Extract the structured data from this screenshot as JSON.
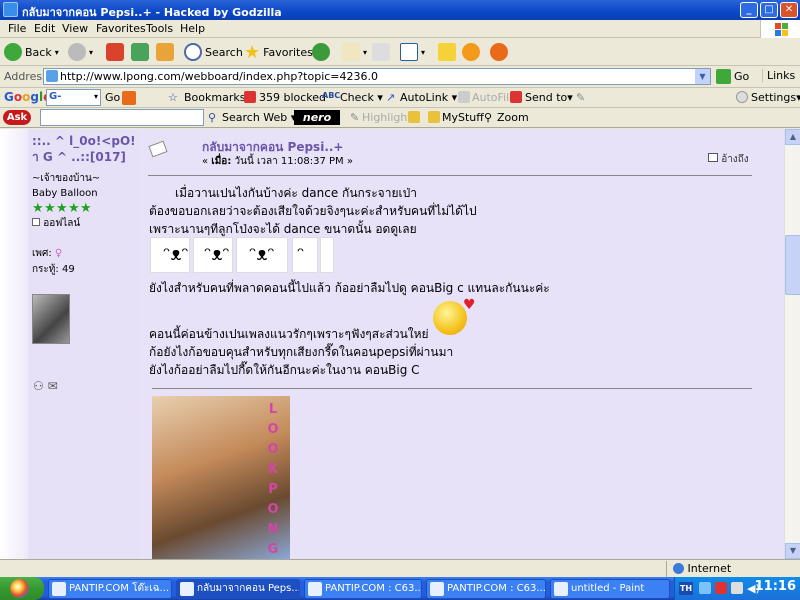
{
  "window": {
    "title": "กลับมาจากคอน Pepsi..+ - Hacked by Godzilla"
  },
  "menu": [
    "File",
    "Edit",
    "View",
    "Favorites",
    "Tools",
    "Help"
  ],
  "toolbar": {
    "back": "Back",
    "search": "Search",
    "favorites": "Favorites"
  },
  "address": {
    "label": "Address",
    "url": "http://www.lpong.com/webboard/index.php?topic=4236.0",
    "go": "Go",
    "links": "Links"
  },
  "googlebar": {
    "logo": "Google",
    "search_placeholder": "G-",
    "go": "Go",
    "bookmarks": "Bookmarks▾",
    "blocked": "359 blocked",
    "check": "Check ▾",
    "autolink": "AutoLink ▾",
    "autofill": "AutoFill",
    "sendto": "Send to▾",
    "settings": "Settings▾"
  },
  "askbar": {
    "logo": "Ask",
    "searchweb": "Search Web ▾",
    "nero": "nero",
    "highlight": "Highlight",
    "mystuff": "MyStuff",
    "zoom": "Zoom"
  },
  "user": {
    "name": "::.. ^ l_0o!<pO!า G ^ ..::[017]",
    "rank": "~เจ้าของบ้าน~",
    "title": "Baby Balloon",
    "status": "ออฟไลน์",
    "gender_label": "เพศ:",
    "posts_label": "กระทู้:",
    "posts": "49"
  },
  "post": {
    "title": "กลับมาจากคอน Pepsi..+",
    "date_prefix": "« ",
    "date_label": "เมื่อ:",
    "date_value": " วันนี้ เวลา 11:08:37 PM »",
    "quote": "อ้างถึง",
    "lines": [
      "เมื่อวานเปนไงกันบ้างค่ะ dance กันกระจายเป่า",
      "ต้องขอบอกเลยว่าจะต้องเสียใจด้วยจิงๆนะค่ะสำหรับคนที่ไม่ได้ไป",
      "เพราะนานๆทีลูกโป่งจะได้ dance ขนาดนั้น อดดูเลย",
      "ยังไงสำหรับคนที่พลาดคอนนี้ไปแล้ว ก้ออย่าลืมไปดู คอนBig c แทนละกันนะค่ะ",
      "คอนนี้ค่อนข้างเปนเพลงแนวรักๆเพราะๆฟังๆสะส่วนใหย่",
      "ก้อยังไงก้อขอบคุนสำหรับทุกเสียงกรี๊ดในคอนpepsiที่ผ่านมา",
      "ยังไงก้ออย่าลืมไปกี๊ดให้กันอีกนะค่ะในงาน คอนBig C"
    ],
    "photo_text": [
      "L",
      "O",
      "O",
      "K",
      "P",
      "O",
      "N",
      "G"
    ]
  },
  "status": {
    "zone": "Internet"
  },
  "taskbar": {
    "tasks": [
      "PANTIP.COM โต๊ะเฉ...",
      "กลับมาจากคอน Peps...",
      "PANTIP.COM : C63...",
      "PANTIP.COM : C63...",
      "untitled - Paint"
    ],
    "tray_lang": "TH",
    "clock": "11:16"
  },
  "colors": {
    "accent": "#6a56a8",
    "panel": "#e8e2f8",
    "taskbar": "#245edb"
  }
}
